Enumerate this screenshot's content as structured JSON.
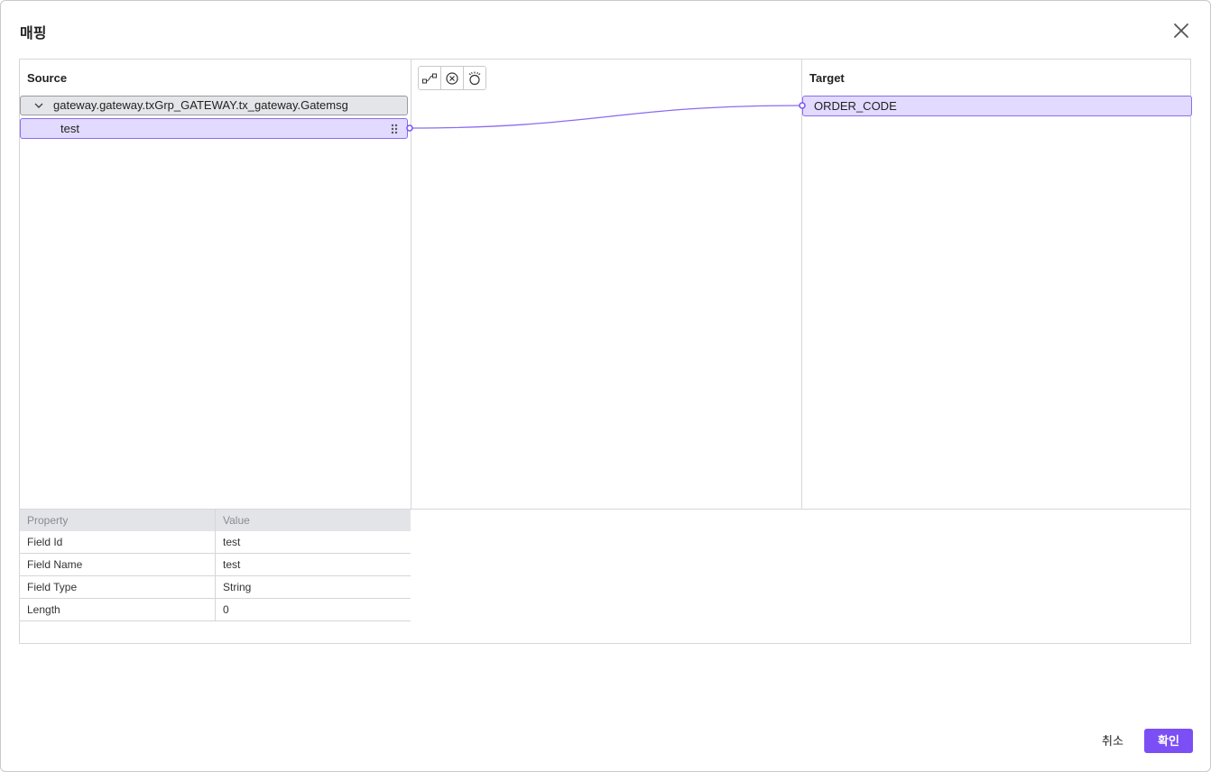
{
  "dialog": {
    "title": "매핑",
    "close_icon": "close-icon"
  },
  "source": {
    "header": "Source",
    "group_label": "gateway.gateway.txGrp_GATEWAY.tx_gateway.Gatemsg",
    "items": [
      {
        "label": "test"
      }
    ]
  },
  "toolbar": {
    "buttons": [
      "auto-map-icon",
      "clear-mapping-icon",
      "lightbulb-icon"
    ]
  },
  "target": {
    "header": "Target",
    "items": [
      {
        "label": "ORDER_CODE"
      }
    ]
  },
  "properties": {
    "headers": [
      "Property",
      "Value"
    ],
    "rows": [
      {
        "property": "Field Id",
        "value": "test"
      },
      {
        "property": "Field Name",
        "value": "test"
      },
      {
        "property": "Field Type",
        "value": "String"
      },
      {
        "property": "Length",
        "value": "0"
      }
    ]
  },
  "footer": {
    "cancel_label": "취소",
    "ok_label": "확인"
  },
  "colors": {
    "accent": "#7b4ff5",
    "selection": "#e2daff",
    "connector": "#8b6cf0"
  }
}
